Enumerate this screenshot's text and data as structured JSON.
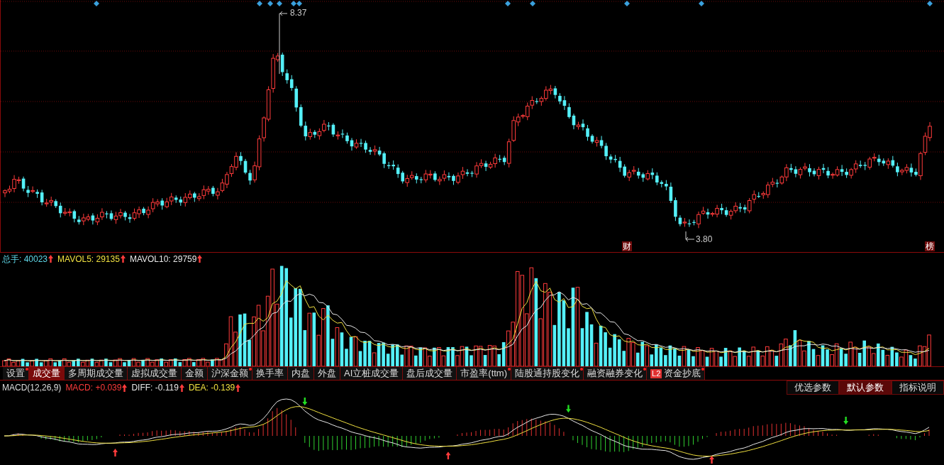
{
  "price_panel": {
    "high_label": "8.37",
    "low_label": "3.80",
    "markers": [
      {
        "text": "财"
      },
      {
        "text": "榜"
      }
    ]
  },
  "volume_header": [
    {
      "text": "总手: 40023",
      "color": "#5fd7e8"
    },
    {
      "text": "MAVOL5: 29135",
      "color": "#f0e040"
    },
    {
      "text": "MAVOL10: 29759",
      "color": "#e8e8e8"
    }
  ],
  "indicator_tabs": [
    {
      "label": "设置",
      "selected": false,
      "dot": true
    },
    {
      "label": "成交量",
      "selected": true,
      "dot": false
    },
    {
      "label": "多周期成交量",
      "selected": false,
      "dot": false
    },
    {
      "label": "虚拟成交量",
      "selected": false,
      "dot": false
    },
    {
      "label": "金额",
      "selected": false,
      "dot": false
    },
    {
      "label": "沪深金额",
      "selected": false,
      "dot": true
    },
    {
      "label": "换手率",
      "selected": false,
      "dot": false
    },
    {
      "label": "内盘",
      "selected": false,
      "dot": false
    },
    {
      "label": "外盘",
      "selected": false,
      "dot": false
    },
    {
      "label": "AI立桩成交量",
      "selected": false,
      "dot": false
    },
    {
      "label": "盘后成交量",
      "selected": false,
      "dot": false
    },
    {
      "label": "市盈率(ttm)",
      "selected": false,
      "dot": true
    },
    {
      "label": "陆股通持股变化",
      "selected": false,
      "dot": true
    },
    {
      "label": "融资融券变化",
      "selected": false,
      "dot": true
    },
    {
      "label": "资金抄底",
      "selected": false,
      "dot": true,
      "badge": "L2"
    }
  ],
  "macd_header": {
    "name": "MACD(12,26,9)",
    "values": [
      {
        "text": "MACD: +0.039",
        "color": "#ff3b3b"
      },
      {
        "text": "DIFF: -0.119",
        "color": "#e8e8e8"
      },
      {
        "text": "DEA: -0.139",
        "color": "#f0e040"
      }
    ]
  },
  "macd_buttons": [
    {
      "label": "优选参数",
      "selected": false
    },
    {
      "label": "默认参数",
      "selected": true
    },
    {
      "label": "指标说明",
      "selected": false
    }
  ]
}
